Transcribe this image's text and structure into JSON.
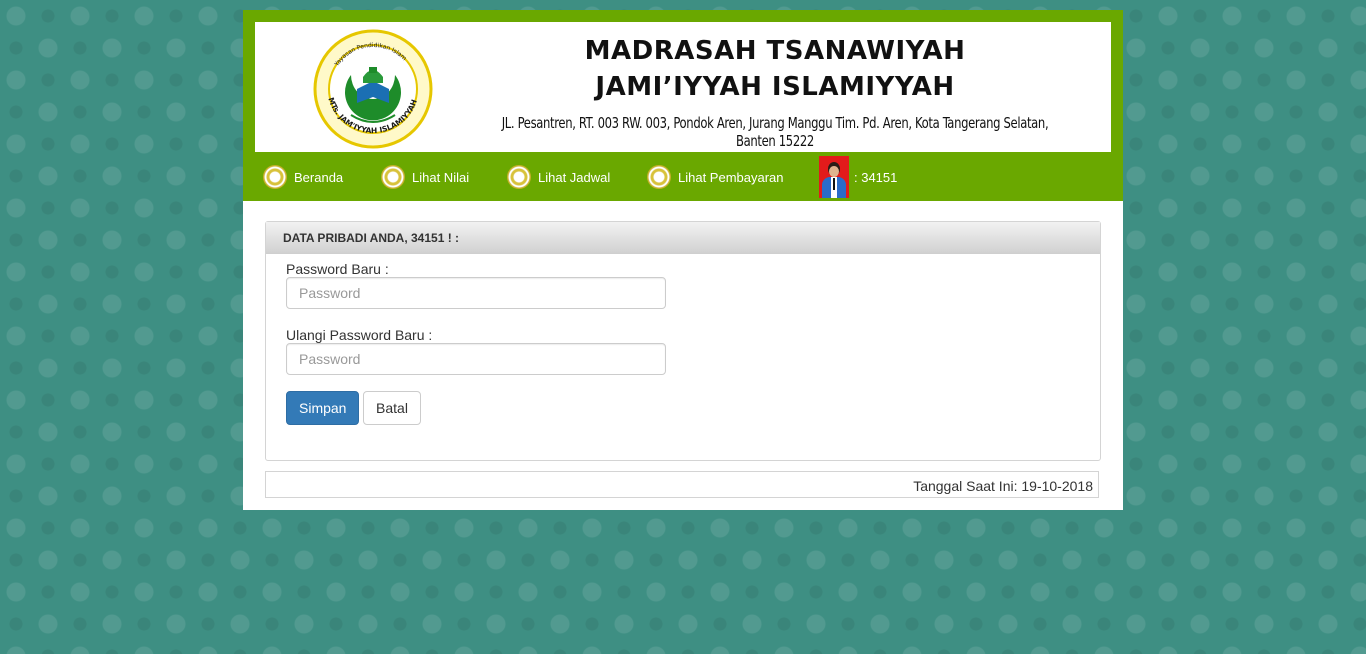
{
  "header": {
    "title_line1": "MADRASAH TSANAWIYAH",
    "title_line2": "JAMI’IYYAH ISLAMIYYAH",
    "address": "JL. Pesantren, RT. 003 RW. 003, Pondok Aren, Jurang Manggu Tim. Pd. Aren, Kota Tangerang Selatan, Banten 15222",
    "logo_text": "MTs. JAM'IYYAH ISLAMIYYAH",
    "logo_subtext": "Yayasan Pendidikan Islam"
  },
  "nav": {
    "items": [
      {
        "label": "Beranda",
        "icon": "school-emblem-icon"
      },
      {
        "label": "Lihat Nilai",
        "icon": "school-emblem-icon"
      },
      {
        "label": "Lihat Jadwal",
        "icon": "school-emblem-icon"
      },
      {
        "label": "Lihat Pembayaran",
        "icon": "school-emblem-icon"
      }
    ],
    "user_label": ":  34151"
  },
  "panel": {
    "heading": "DATA PRIBADI ANDA, 34151 ! :",
    "new_password_label": "Password Baru :",
    "new_password_placeholder": "Password",
    "new_password_value": "",
    "repeat_password_label": "Ulangi Password Baru :",
    "repeat_password_placeholder": "Password",
    "repeat_password_value": "",
    "save_label": "Simpan",
    "cancel_label": "Batal"
  },
  "footer": {
    "date_text": "Tanggal Saat Ini: 19-10-2018"
  },
  "colors": {
    "nav_green": "#6aa800",
    "background_teal": "#3e8f83",
    "primary_blue": "#337ab7"
  }
}
